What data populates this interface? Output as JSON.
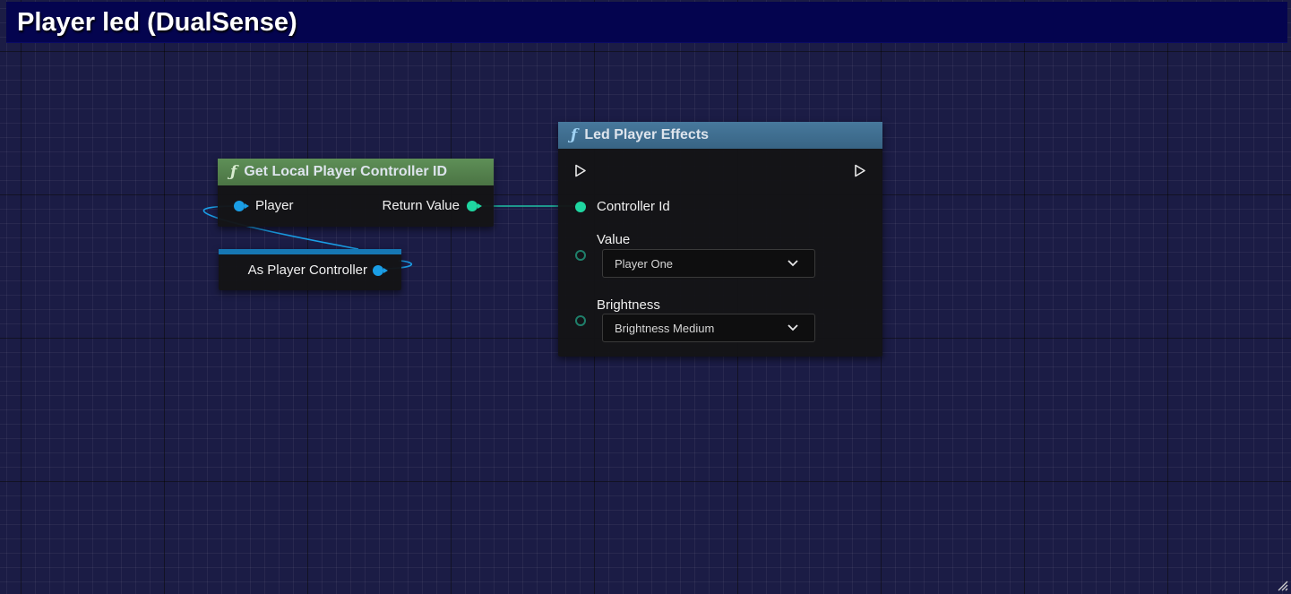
{
  "window": {
    "title": "Player led (DualSense)"
  },
  "colors": {
    "canvas": "#1b1c45",
    "title_bar": "#04044f",
    "object_pin": "#1a9ee6",
    "integer_pin": "#1fd6a1",
    "enum_pin": "#1f7f6a",
    "pure_function_header": "#55834f",
    "function_header": "#3f6c8f",
    "cast_bar": "#1677b3"
  },
  "nodes": {
    "get_local_player_controller_id": {
      "icon": "function-icon",
      "title": "Get Local Player Controller ID",
      "input_pin_label": "Player",
      "output_pin_label": "Return Value"
    },
    "cast_to_player_controller": {
      "output_pin_label": "As Player Controller"
    },
    "led_player_effects": {
      "icon": "function-icon",
      "title": "Led Player Effects",
      "controller_id_label": "Controller Id",
      "value_label": "Value",
      "value_selected": "Player One",
      "brightness_label": "Brightness",
      "brightness_selected": "Brightness Medium"
    }
  }
}
